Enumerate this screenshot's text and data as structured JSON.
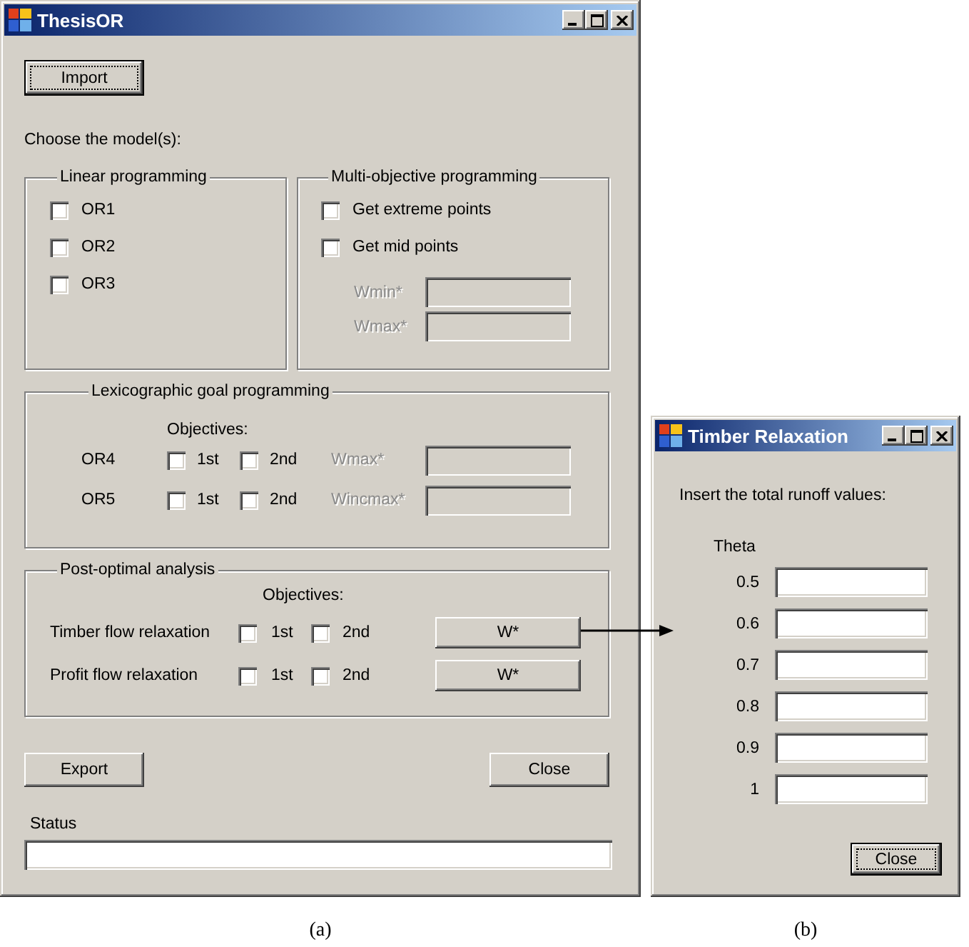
{
  "main_window": {
    "title": "ThesisOR",
    "import_button": {
      "label": "Import",
      "focused": true
    },
    "prompt": "Choose the model(s):",
    "linear_programming": {
      "title": "Linear programming",
      "options": [
        {
          "label": "OR1",
          "checked": false
        },
        {
          "label": "OR2",
          "checked": false
        },
        {
          "label": "OR3",
          "checked": false
        }
      ]
    },
    "multi_objective_programming": {
      "title": "Multi-objective programming",
      "options": [
        {
          "label": "Get extreme points",
          "checked": false
        },
        {
          "label": "Get mid points",
          "checked": false
        }
      ],
      "fields": [
        {
          "label": "Wmin*",
          "disabled": true
        },
        {
          "label": "Wmax*",
          "disabled": true
        }
      ]
    },
    "lexicographic_goal_programming": {
      "title": "Lexicographic goal programming",
      "objectives_heading": "Objectives:",
      "rows": [
        {
          "label": "OR4",
          "objectives": [
            {
              "label": "1st",
              "checked": false
            },
            {
              "label": "2nd",
              "checked": false
            }
          ],
          "field": {
            "label": "Wmax*",
            "disabled": true
          }
        },
        {
          "label": "OR5",
          "objectives": [
            {
              "label": "1st",
              "checked": false
            },
            {
              "label": "2nd",
              "checked": false
            }
          ],
          "field": {
            "label": "Wincmax*",
            "disabled": true
          }
        }
      ]
    },
    "post_optimal_analysis": {
      "title": "Post-optimal analysis",
      "objectives_heading": "Objectives:",
      "rows": [
        {
          "label": "Timber flow relaxation",
          "objectives": [
            {
              "label": "1st",
              "checked": false
            },
            {
              "label": "2nd",
              "checked": false
            }
          ],
          "button": {
            "label": "W*",
            "focused": false
          }
        },
        {
          "label": "Profit flow relaxation",
          "objectives": [
            {
              "label": "1st",
              "checked": false
            },
            {
              "label": "2nd",
              "checked": false
            }
          ],
          "button": {
            "label": "W*",
            "focused": false
          }
        }
      ]
    },
    "export_button": {
      "label": "Export",
      "focused": false
    },
    "close_button": {
      "label": "Close",
      "focused": false
    },
    "status": {
      "label": "Status"
    }
  },
  "main_caption": "(a)",
  "dialog": {
    "title": "Timber Relaxation",
    "prompt": "Insert the total runoff values:",
    "column_heading": "Theta",
    "rows": [
      {
        "label": "0.5"
      },
      {
        "label": "0.6"
      },
      {
        "label": "0.7"
      },
      {
        "label": "0.8"
      },
      {
        "label": "0.9"
      },
      {
        "label": "1"
      }
    ],
    "close_button": {
      "label": "Close",
      "focused": true
    }
  },
  "dialog_caption": "(b)"
}
